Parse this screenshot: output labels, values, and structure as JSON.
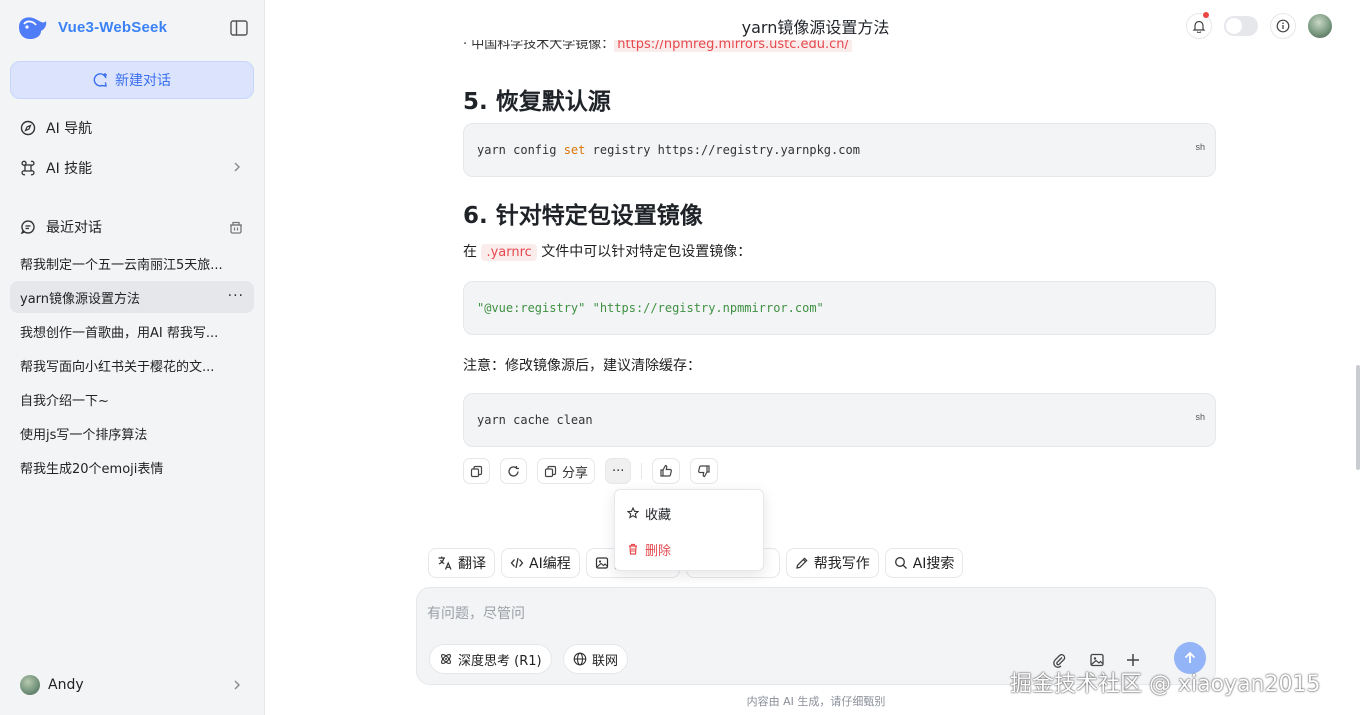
{
  "app": {
    "name": "Vue3-WebSeek"
  },
  "sidebar": {
    "new_chat_label": "新建对话",
    "nav": [
      {
        "label": "AI 导航",
        "icon": "compass-icon"
      },
      {
        "label": "AI 技能",
        "icon": "command-icon"
      }
    ],
    "recent_label": "最近对话",
    "chats": [
      {
        "title": "帮我制定一个五一云南丽江5天旅..."
      },
      {
        "title": "yarn镜像源设置方法",
        "active": true,
        "more": "···"
      },
      {
        "title": "我想创作一首歌曲，用AI 帮我写..."
      },
      {
        "title": "帮我写面向小红书关于樱花的文..."
      },
      {
        "title": "自我介绍一下~"
      },
      {
        "title": "使用js写一个排序算法"
      },
      {
        "title": "帮我生成20个emoji表情"
      }
    ],
    "user": {
      "name": "Andy"
    }
  },
  "header": {
    "title": "yarn镜像源设置方法"
  },
  "content": {
    "cut_prefix": "· 中国科学技术大学镜像：",
    "cut_link": "https://npmreg.mirrors.ustc.edu.cn/",
    "section5": {
      "title": "5. 恢复默认源",
      "code_pre": "yarn config ",
      "code_kw": "set",
      "code_post": " registry https://registry.yarnpkg.com",
      "lang": "sh"
    },
    "section6": {
      "title": "6. 针对特定包设置镜像",
      "para_pre": "在",
      "para_code": ".yarnrc",
      "para_post": "文件中可以针对特定包设置镜像：",
      "code": "\"@vue:registry\" \"https://registry.npmmirror.com\""
    },
    "note": "注意：修改镜像源后，建议清除缓存：",
    "cache_code": "yarn cache clean",
    "cache_lang": "sh"
  },
  "actions": {
    "share_label": "分享",
    "more_label": "···"
  },
  "dropdown": {
    "favorite_label": "收藏",
    "delete_label": "删除"
  },
  "tools": [
    {
      "label": "翻译",
      "icon": "translate-icon"
    },
    {
      "label": "AI编程",
      "icon": "code-icon"
    },
    {
      "label": "图",
      "icon": "image-icon"
    },
    {
      "label": "",
      "icon": ""
    },
    {
      "label": "帮我写作",
      "icon": "pen-icon"
    },
    {
      "label": "AI搜索",
      "icon": "search-icon"
    }
  ],
  "input": {
    "placeholder": "有问题，尽管问",
    "deep_think_label": "深度思考 (R1)",
    "web_label": "联网"
  },
  "footer": {
    "disclaimer": "内容由 AI 生成，请仔细甄别",
    "watermark": "掘金技术社区 @ xiaoyan2015"
  },
  "colors": {
    "accent": "#3b82f6",
    "danger": "#e5484d",
    "sidebar_bg": "#f3f4f6"
  }
}
